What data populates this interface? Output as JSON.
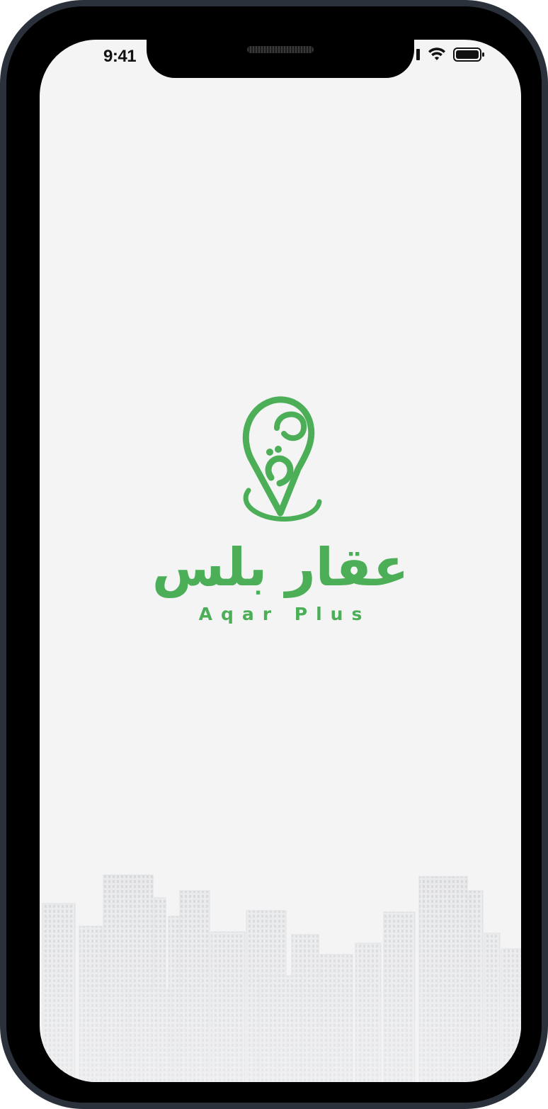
{
  "status_bar": {
    "time": "9:41",
    "wifi_icon": "wifi-icon",
    "battery_icon": "battery-icon"
  },
  "splash": {
    "logo_icon": "location-pin-logo-icon",
    "app_name_ar": "عقار بلس",
    "app_name_en": "Aqar Plus",
    "background_icon": "city-skyline-illustration"
  },
  "colors": {
    "brand_green": "#4caf58",
    "screen_background": "#f4f4f5",
    "skyline": "#e4e5e7"
  }
}
